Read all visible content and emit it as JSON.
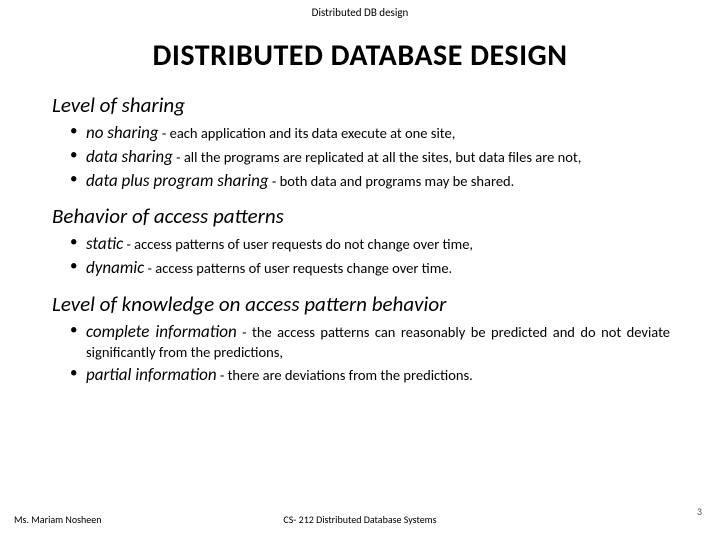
{
  "header_small": "Distributed DB design",
  "title": "DISTRIBUTED DATABASE DESIGN",
  "sections": [
    {
      "heading": "Level of sharing",
      "items": [
        {
          "term": "no sharing",
          "sep": " - ",
          "desc": "each application and its data execute at one site,"
        },
        {
          "term": "data sharing",
          "sep": " - ",
          "desc": "all the programs are replicated at all the sites, but data files are not,",
          "wrap_after": "data"
        },
        {
          "term": "data plus program sharing",
          "sep": " - ",
          "desc": "both data and programs may be shared."
        }
      ]
    },
    {
      "heading": "Behavior of access patterns",
      "items": [
        {
          "term": "static",
          "sep": " - ",
          "desc": "access patterns of user requests do not change over time,"
        },
        {
          "term": "dynamic",
          "sep": " - ",
          "desc": "access patterns of user requests change over time."
        }
      ]
    },
    {
      "heading": "Level of knowledge on access pattern behavior",
      "items": [
        {
          "term": "complete information",
          "sep": " - ",
          "desc": "the access patterns can reasonably be predicted and do not deviate significantly from the predictions,"
        },
        {
          "term": "partial information",
          "sep": " - ",
          "desc": "there are deviations from the predictions."
        }
      ]
    }
  ],
  "footer": {
    "left": "Ms. Mariam Nosheen",
    "center": "CS- 212 Distributed Database Systems",
    "right": "3"
  }
}
